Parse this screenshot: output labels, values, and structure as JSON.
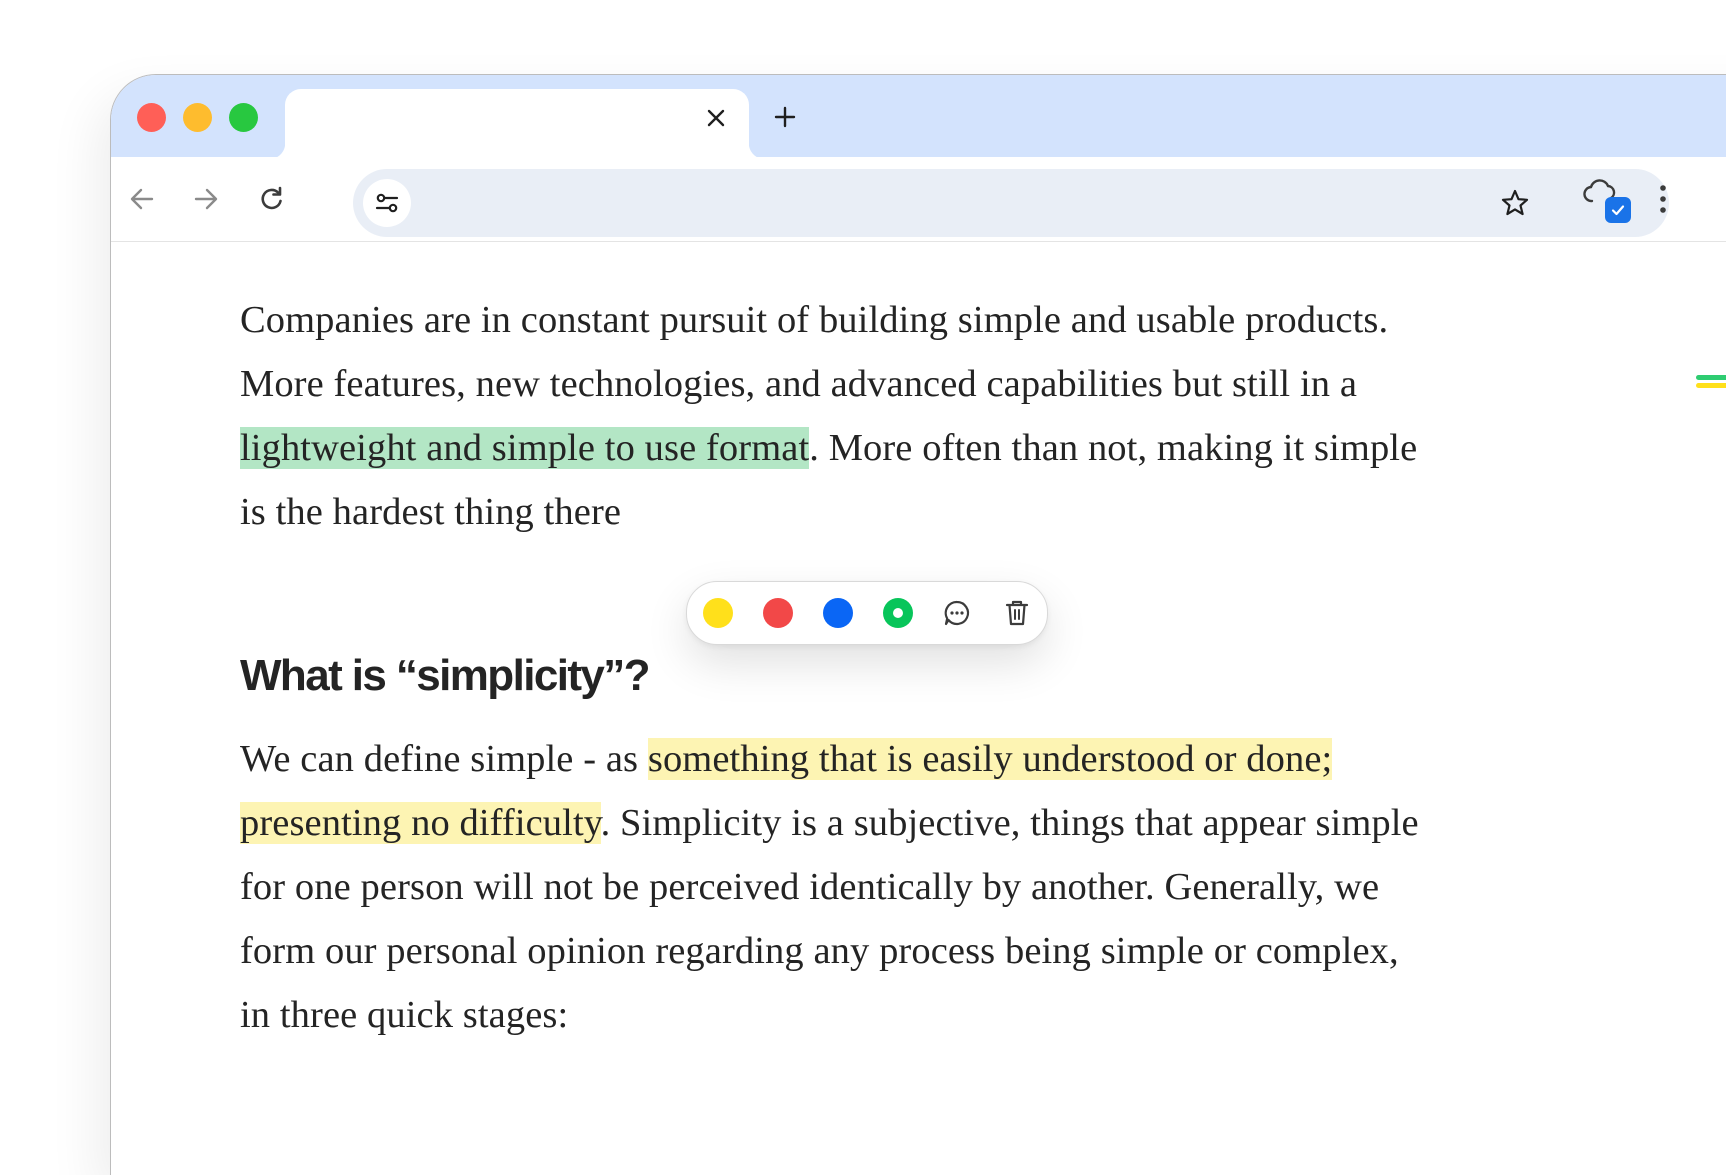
{
  "browser": {
    "tab_title": "",
    "tab_close_glyph": "✕",
    "new_tab_glyph": "+",
    "omnibox_value": "",
    "icons": {
      "back": "arrow-left-icon",
      "forward": "arrow-right-icon",
      "reload": "reload-icon",
      "site_info": "tune-icon",
      "bookmark": "star-icon",
      "extension": "cloud-check-icon",
      "menu": "kebab-menu-icon"
    }
  },
  "article": {
    "paragraph1": {
      "line1": "Companies are in constant pursuit of building simple and usable products.",
      "line2": "More features, new technologies, and advanced capabilities but still in a",
      "line3_highlight": "lightweight and simple to use format",
      "line3_rest": ". More often than not, making it simple",
      "line4": "is the hardest thing there"
    },
    "heading": "What is “simplicity”?",
    "paragraph2": {
      "line1_start": "We can define simple - as ",
      "line1_highlight": "something that is easily understood or done;",
      "line2_highlight": "presenting no difficulty",
      "line2_rest": ". Simplicity is a subjective, things that appear simple",
      "line3": "for one person will not be perceived identically by another. Generally, we",
      "line4": "form our personal opinion regarding any process being simple or complex,",
      "line5": "in three quick stages:"
    }
  },
  "highlight_toolbar": {
    "colors": [
      {
        "name": "yellow",
        "hex": "#ffe01b"
      },
      {
        "name": "red",
        "hex": "#f24848"
      },
      {
        "name": "blue",
        "hex": "#0a66f5"
      },
      {
        "name": "green",
        "hex": "#08c55a",
        "selected": true
      }
    ],
    "actions": [
      "comment-icon",
      "trash-icon"
    ]
  },
  "colors": {
    "tabbar_bg": "#d3e3fd",
    "highlight_green": "#b3e6c5",
    "highlight_yellow": "#fdf4b3",
    "scroll_marker_green": "#2ecc71",
    "scroll_marker_yellow": "#ffe01b"
  }
}
